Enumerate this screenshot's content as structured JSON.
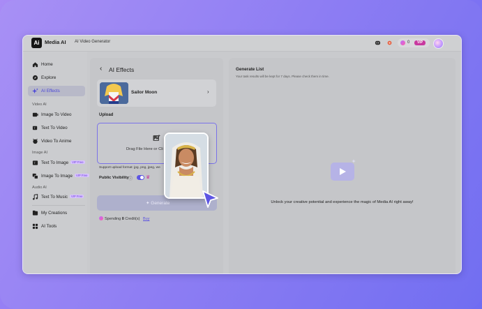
{
  "header": {
    "logo_text": "Ai",
    "app_name": "Media AI",
    "page_tab": "AI Video Generator",
    "credits": "0",
    "vip_badge": "VIP",
    "icons": [
      "discord-icon",
      "record-icon",
      "coin-icon",
      "avatar"
    ]
  },
  "sidebar": {
    "items": [
      {
        "label": "Home",
        "icon": "home-icon",
        "active": false
      },
      {
        "label": "Explore",
        "icon": "compass-icon",
        "active": false
      },
      {
        "label": "AI Effects",
        "icon": "sparkle-icon",
        "active": true
      }
    ],
    "section_video": "Video AI",
    "video_items": [
      {
        "label": "Image To Video",
        "icon": "image-video-icon"
      },
      {
        "label": "Text To Video",
        "icon": "text-video-icon"
      },
      {
        "label": "Video To Anime",
        "icon": "anime-icon"
      }
    ],
    "section_image": "Image AI",
    "image_items": [
      {
        "label": "Text To Image",
        "icon": "text-image-icon",
        "badge": "VIP Free"
      },
      {
        "label": "Image To Image",
        "icon": "image-image-icon",
        "badge": "VIP Free"
      }
    ],
    "section_audio": "Audio AI",
    "audio_items": [
      {
        "label": "Text To Music",
        "icon": "music-icon",
        "badge": "VIP Free"
      }
    ],
    "bottom_items": [
      {
        "label": "My Creations",
        "icon": "creations-icon"
      },
      {
        "label": "AI Tools",
        "icon": "tools-icon"
      }
    ]
  },
  "panel": {
    "title": "AI Effects",
    "effect_name": "Sailor Moon",
    "upload_label": "Upload",
    "drop_text": "Drag File Here or Cli",
    "format_text": "Support upload format: jpg, png, jpeg, we",
    "visibility_label": "Public Visibility",
    "public_visibility_on": true,
    "generate_label": "Generate",
    "spending_prefix": "Spending",
    "spending_amount": "8",
    "spending_suffix": "Credit(s)",
    "buy_label": "Buy"
  },
  "result": {
    "title": "Generate List",
    "subtitle": "Your task results will be kept for 7 days. Please check them in time.",
    "empty_text": "Unlock your creative potential and experience the magic of Media AI right away!"
  },
  "colors": {
    "accent": "#5d55e3",
    "vip": "#c8399f",
    "background_gradient_start": "#a98bf6",
    "background_gradient_end": "#6f6cf2"
  }
}
